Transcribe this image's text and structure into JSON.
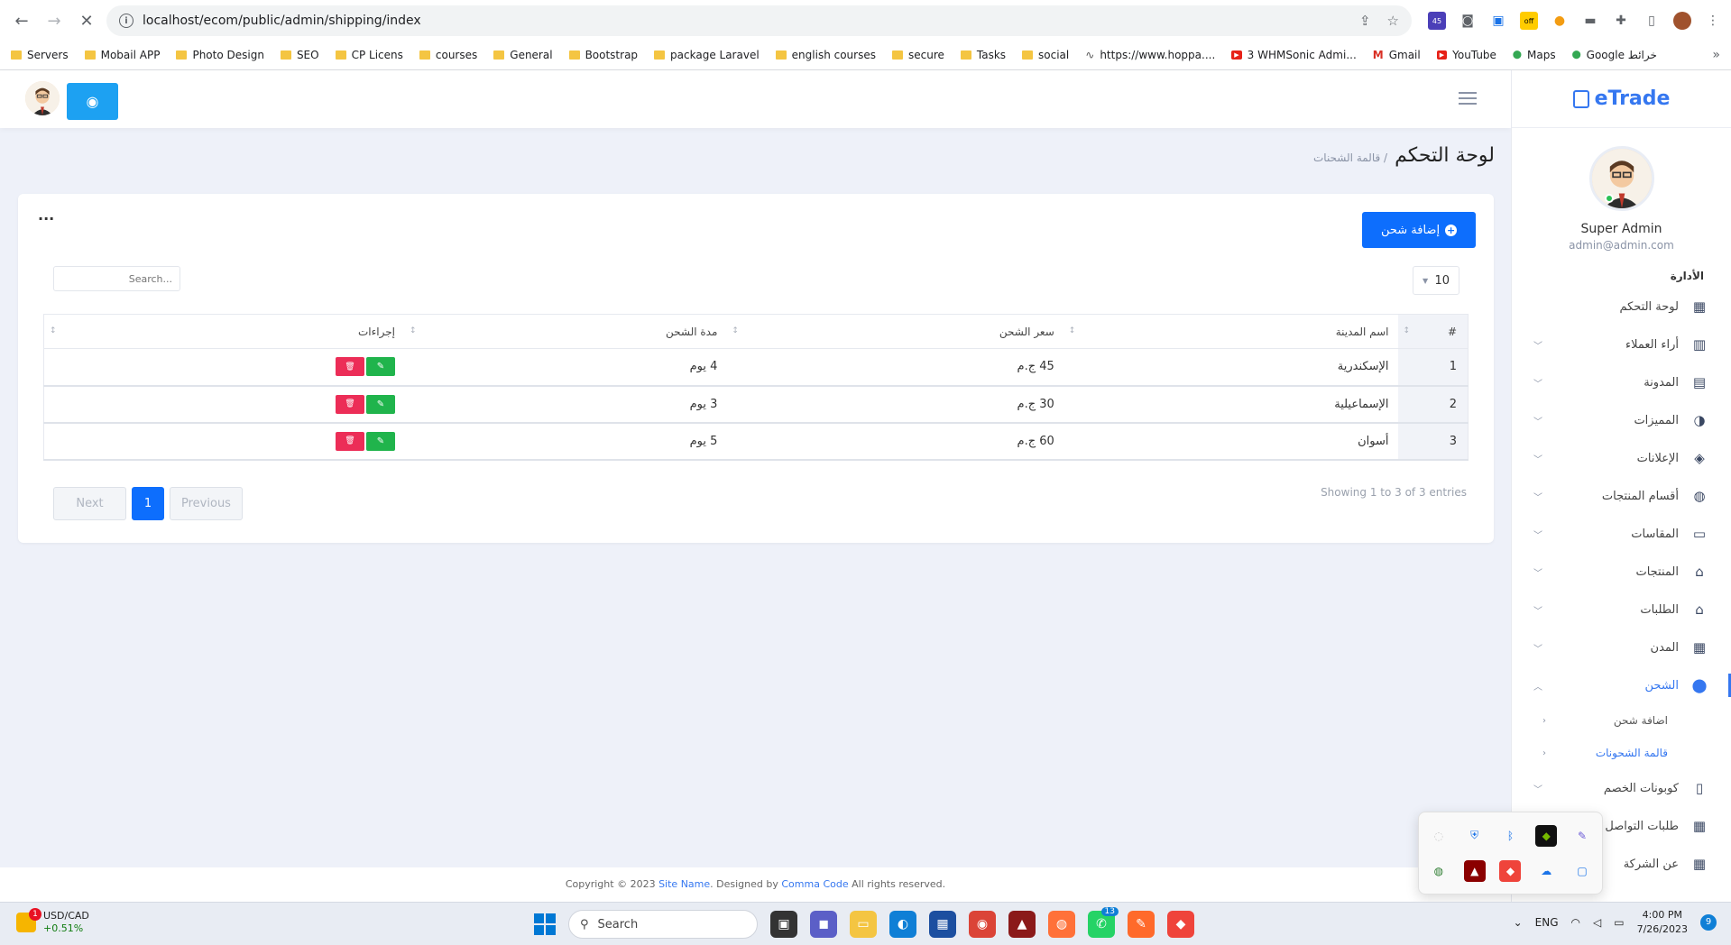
{
  "browser": {
    "url": "localhost/ecom/public/admin/shipping/index",
    "bookmarks": [
      {
        "label": "Servers",
        "type": "folder"
      },
      {
        "label": "Mobail APP",
        "type": "folder"
      },
      {
        "label": "Photo Design",
        "type": "folder"
      },
      {
        "label": "SEO",
        "type": "folder"
      },
      {
        "label": "CP Licens",
        "type": "folder"
      },
      {
        "label": "courses",
        "type": "folder"
      },
      {
        "label": "General",
        "type": "folder"
      },
      {
        "label": "Bootstrap",
        "type": "folder"
      },
      {
        "label": "package Laravel",
        "type": "folder"
      },
      {
        "label": "english courses",
        "type": "folder"
      },
      {
        "label": "secure",
        "type": "folder"
      },
      {
        "label": "Tasks",
        "type": "folder"
      },
      {
        "label": "social",
        "type": "folder"
      },
      {
        "label": "https://www.hoppa....",
        "type": "link"
      },
      {
        "label": "3 WHMSonic Admi...",
        "type": "youtube"
      },
      {
        "label": "Gmail",
        "type": "gmail"
      },
      {
        "label": "YouTube",
        "type": "youtube"
      },
      {
        "label": "Maps",
        "type": "maps"
      },
      {
        "label": "Google خرائط",
        "type": "maps"
      }
    ],
    "extension_badge": "45",
    "off_badge": "off"
  },
  "sidebar": {
    "brand": "eTrade",
    "user_name": "Super Admin",
    "user_email": "admin@admin.com",
    "section_label": "الأدارة",
    "items": [
      {
        "label": "لوحة التحكم",
        "icon": "grid-icon",
        "glyph": "▦",
        "chevron": false
      },
      {
        "label": "أراء العملاء",
        "icon": "chart-icon",
        "glyph": "▥",
        "chevron": true
      },
      {
        "label": "المدونة",
        "icon": "document-icon",
        "glyph": "▤",
        "chevron": true
      },
      {
        "label": "المميزات",
        "icon": "pie-icon",
        "glyph": "◑",
        "chevron": true
      },
      {
        "label": "الإعلانات",
        "icon": "layers-icon",
        "glyph": "◈",
        "chevron": true
      },
      {
        "label": "أقسام المنتجات",
        "icon": "palette-icon",
        "glyph": "◍",
        "chevron": true
      },
      {
        "label": "المقاسات",
        "icon": "chat-icon",
        "glyph": "▭",
        "chevron": true
      },
      {
        "label": "المنتجات",
        "icon": "basket-icon",
        "glyph": "⌂",
        "chevron": true
      },
      {
        "label": "الطلبات",
        "icon": "basket-icon",
        "glyph": "⌂",
        "chevron": true
      },
      {
        "label": "المدن",
        "icon": "table-icon",
        "glyph": "▦",
        "chevron": true
      },
      {
        "label": "الشحن",
        "icon": "location-pin-icon",
        "glyph": "⬤",
        "chevron": true,
        "active": true
      }
    ],
    "submenu": [
      {
        "label": "اضافة شحن"
      },
      {
        "label": "قالمة الشحونات",
        "active": true
      }
    ],
    "items_after": [
      {
        "label": "كوبونات الخصم",
        "icon": "book-icon",
        "glyph": "▯",
        "chevron": true
      },
      {
        "label": "طلبات التواصل",
        "icon": "grid-icon",
        "glyph": "▦",
        "chevron": true
      },
      {
        "label": "عن الشركة",
        "icon": "grid-icon",
        "glyph": "▦",
        "chevron": true
      }
    ]
  },
  "page": {
    "title": "لوحة التحكم",
    "breadcrumb": "/ قالمة الشحنات",
    "add_button": "إضافة شحن",
    "more_dots": "...",
    "page_length": "10",
    "search_placeholder": "Search...",
    "table": {
      "headers": [
        "#",
        "اسم المدينة",
        "سعر الشحن",
        "مدة الشحن",
        "إجراءات"
      ],
      "rows": [
        {
          "num": "1",
          "city": "الإسكندرية",
          "price": "45 ج.م",
          "duration": "4 يوم"
        },
        {
          "num": "2",
          "city": "الإسماعيلية",
          "price": "30 ج.م",
          "duration": "3 يوم"
        },
        {
          "num": "3",
          "city": "أسوان",
          "price": "60 ج.م",
          "duration": "5 يوم"
        }
      ]
    },
    "showing": "Showing 1 to 3 of 3 entries",
    "pagination": {
      "previous": "Previous",
      "current": "1",
      "next": "Next"
    }
  },
  "footer": {
    "copyright_prefix": "Copyright © 2023",
    "site_name": "Site Name",
    "designed_by": ". Designed by",
    "company": "Comma Code",
    "rights": "All rights reserved."
  },
  "taskbar": {
    "ticker_symbol": "USD/CAD",
    "ticker_change": "+0.51%",
    "ticker_badge": "1",
    "search_label": "Search",
    "whatsapp_badge": "13",
    "language": "ENG",
    "time": "4:00 PM",
    "date": "7/26/2023",
    "notifications": "9"
  },
  "colors": {
    "primary": "#0d6efd",
    "brand": "#3577f0",
    "danger": "#ec2d57",
    "success": "#20b44c",
    "eye_button": "#1da1f2"
  }
}
